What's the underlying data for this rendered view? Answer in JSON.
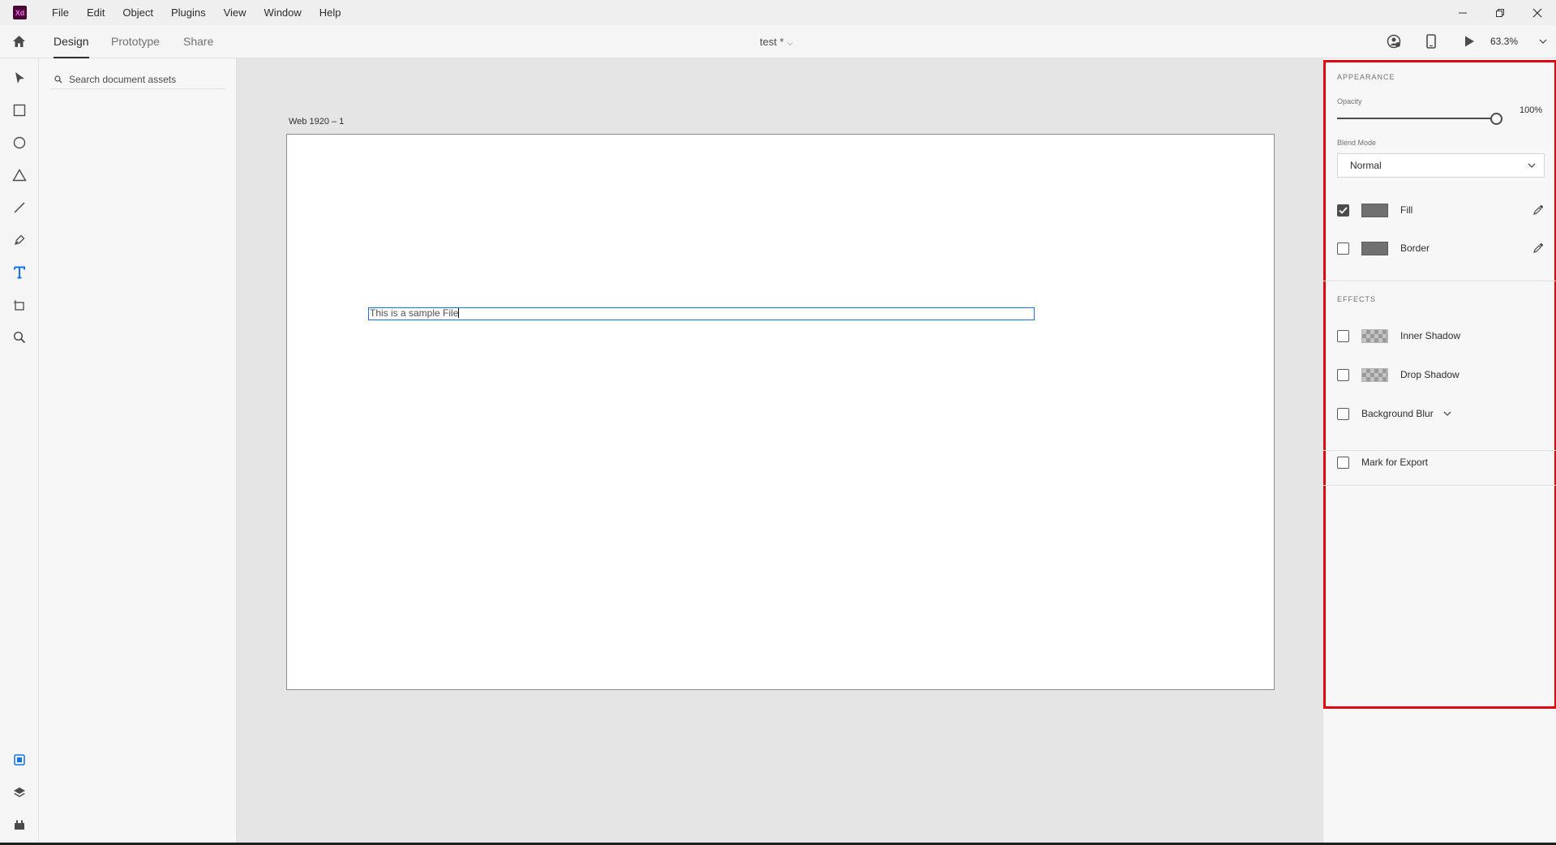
{
  "app": {
    "logo_text": "Xd",
    "logo_bg": "#470137",
    "logo_fg": "#ff61f6"
  },
  "menu": [
    "File",
    "Edit",
    "Object",
    "Plugins",
    "View",
    "Window",
    "Help"
  ],
  "tabs": {
    "design": "Design",
    "prototype": "Prototype",
    "share": "Share"
  },
  "document": {
    "title": "test *"
  },
  "zoom": {
    "value": "63.3%"
  },
  "toolbar": {
    "tools": [
      "select-icon",
      "rectangle-icon",
      "ellipse-icon",
      "polygon-icon",
      "line-icon",
      "pen-icon",
      "text-icon",
      "artboard-icon",
      "zoom-icon"
    ],
    "bottom": [
      "assets-icon",
      "layers-icon",
      "plugins-icon"
    ],
    "active_color": "#1473e6"
  },
  "assets": {
    "search_placeholder": "Search document assets"
  },
  "canvas": {
    "artboard_name": "Web 1920 – 1",
    "text_content": "This is a sample File",
    "selection_color": "#1473e6"
  },
  "properties": {
    "appearance_title": "APPEARANCE",
    "opacity_label": "Opacity",
    "opacity_value": "100%",
    "opacity_level": 1.0,
    "blend_label": "Blend Mode",
    "blend_value": "Normal",
    "fill_label": "Fill",
    "fill_checked": true,
    "border_label": "Border",
    "border_checked": false,
    "effects_title": "EFFECTS",
    "inner_shadow_label": "Inner Shadow",
    "drop_shadow_label": "Drop Shadow",
    "background_blur_label": "Background Blur",
    "mark_export_label": "Mark for Export",
    "highlight_color": "#e1060f"
  }
}
